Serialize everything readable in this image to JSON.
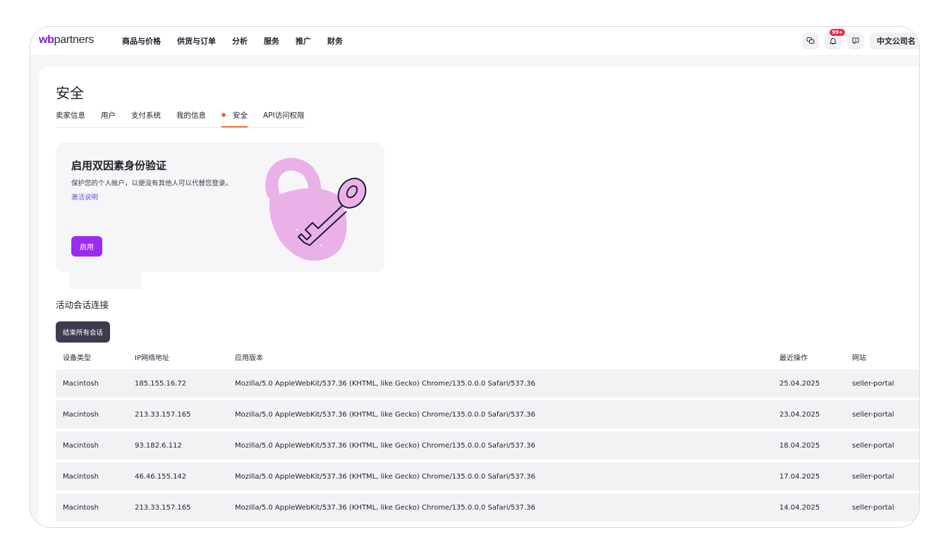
{
  "header": {
    "logo_wb": "wb",
    "logo_rest": "partners",
    "nav": [
      "商品与价格",
      "供货与订单",
      "分析",
      "服务",
      "推广",
      "财务"
    ],
    "notifications_badge": "99+",
    "company_name": "中文公司名"
  },
  "page": {
    "title": "安全",
    "tabs": [
      {
        "label": "卖家信息",
        "active": false
      },
      {
        "label": "用户",
        "active": false
      },
      {
        "label": "支付系统",
        "active": false
      },
      {
        "label": "我的信息",
        "active": false
      },
      {
        "label": "安全",
        "active": true
      },
      {
        "label": "API访问权限",
        "active": false
      }
    ]
  },
  "twofa": {
    "title": "启用双因素身份验证",
    "description": "保护您的个人帐户，以便没有其他人可以代替您登录。",
    "link": "激活说明",
    "button": "启用"
  },
  "sessions": {
    "title": "活动会话连接",
    "end_all_button": "结束所有会话",
    "columns": [
      "设备类型",
      "IP网络地址",
      "应用版本",
      "最近操作",
      "网站"
    ],
    "rows": [
      {
        "device": "Macintosh",
        "ip": "185.155.16.72",
        "app": "Mozilla/5.0 AppleWebKit/537.36 (KHTML, like Gecko) Chrome/135.0.0.0 Safari/537.36",
        "last": "25.04.2025",
        "site": "seller-portal"
      },
      {
        "device": "Macintosh",
        "ip": "213.33.157.165",
        "app": "Mozilla/5.0 AppleWebKit/537.36 (KHTML, like Gecko) Chrome/135.0.0.0 Safari/537.36",
        "last": "23.04.2025",
        "site": "seller-portal"
      },
      {
        "device": "Macintosh",
        "ip": "93.182.6.112",
        "app": "Mozilla/5.0 AppleWebKit/537.36 (KHTML, like Gecko) Chrome/135.0.0.0 Safari/537.36",
        "last": "18.04.2025",
        "site": "seller-portal"
      },
      {
        "device": "Macintosh",
        "ip": "46.46.155.142",
        "app": "Mozilla/5.0 AppleWebKit/537.36 (KHTML, like Gecko) Chrome/135.0.0.0 Safari/537.36",
        "last": "17.04.2025",
        "site": "seller-portal"
      },
      {
        "device": "Macintosh",
        "ip": "213.33.157.165",
        "app": "Mozilla/5.0 AppleWebKit/537.36 (KHTML, like Gecko) Chrome/135.0.0.0 Safari/537.36",
        "last": "14.04.2025",
        "site": "seller-portal"
      }
    ]
  },
  "icons": {
    "chat": "chat-icon",
    "bell": "bell-icon",
    "help": "help-icon",
    "lock": "padlock-key-illustration"
  },
  "colors": {
    "accent_purple": "#9b2bf0",
    "tab_indicator": "#f26b3a",
    "link": "#5a55d8",
    "badge": "#f2274b",
    "dark_button": "#3c3c4e",
    "lock_pink": "#eab0e8"
  }
}
